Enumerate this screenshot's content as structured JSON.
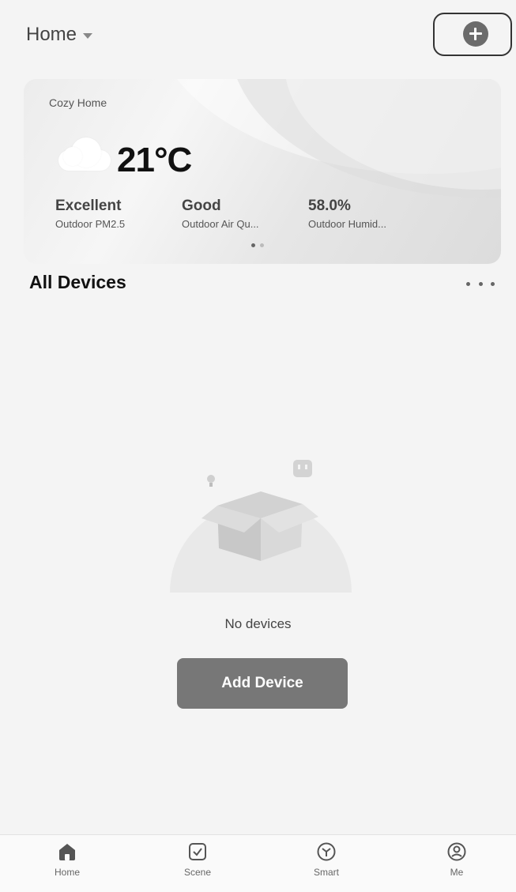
{
  "header": {
    "home_name": "Home"
  },
  "weather_card": {
    "title": "Cozy Home",
    "icon": "cloud-icon",
    "temperature": "21°C",
    "stats": [
      {
        "value": "Excellent",
        "label": "Outdoor PM2.5"
      },
      {
        "value": "Good",
        "label": "Outdoor Air Qu..."
      },
      {
        "value": "58.0%",
        "label": "Outdoor Humid..."
      }
    ]
  },
  "devices_section": {
    "title": "All Devices"
  },
  "empty_state": {
    "message": "No devices",
    "button_label": "Add Device"
  },
  "bottom_nav": {
    "items": [
      {
        "label": "Home",
        "icon": "home-icon",
        "active": true
      },
      {
        "label": "Scene",
        "icon": "scene-checkbox-icon",
        "active": false
      },
      {
        "label": "Smart",
        "icon": "smart-icon",
        "active": false
      },
      {
        "label": "Me",
        "icon": "profile-icon",
        "active": false
      }
    ]
  },
  "colors": {
    "background": "#f4f4f4",
    "accent_button": "#777777",
    "text_primary": "#111111"
  }
}
